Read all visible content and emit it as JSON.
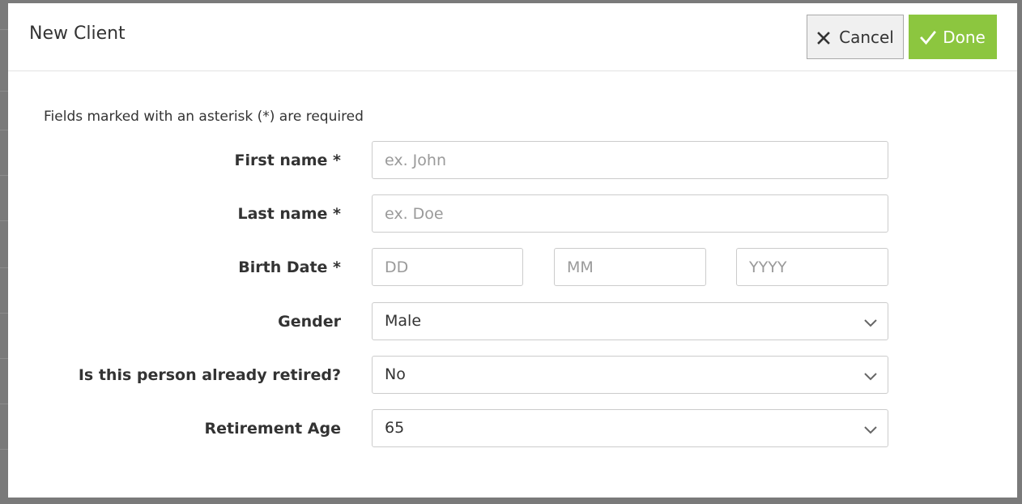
{
  "modal": {
    "title": "New Client",
    "cancel_label": "Cancel",
    "done_label": "Done",
    "required_note": "Fields marked with an asterisk (*) are required"
  },
  "colors": {
    "done_bg": "#8cc63f",
    "cancel_bg": "#f0f0f0"
  },
  "form": {
    "first_name": {
      "label": "First name *",
      "value": "",
      "placeholder": "ex. John"
    },
    "last_name": {
      "label": "Last name *",
      "value": "",
      "placeholder": "ex. Doe"
    },
    "birth_date": {
      "label": "Birth Date *",
      "day_placeholder": "DD",
      "month_placeholder": "MM",
      "year_placeholder": "YYYY"
    },
    "gender": {
      "label": "Gender",
      "value": "Male"
    },
    "retired": {
      "label": "Is this person already retired?",
      "value": "No"
    },
    "retirement_age": {
      "label": "Retirement Age",
      "value": "65"
    }
  },
  "icons": {
    "cancel": "close-icon",
    "done": "check-icon",
    "select": "chevron-down-icon"
  }
}
